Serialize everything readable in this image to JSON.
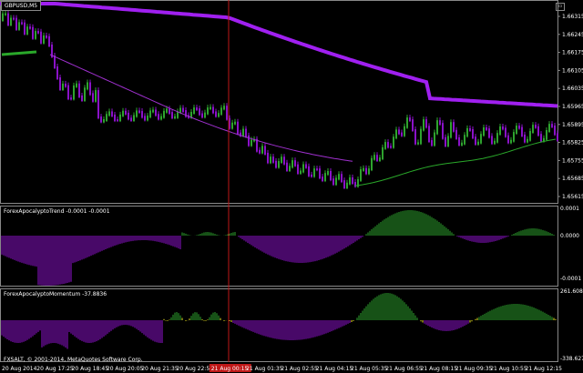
{
  "symbol_label": "GBPUSD,M5",
  "corner_button": "▭",
  "colors": {
    "background": "#000000",
    "bull": "#2ea32e",
    "bear": "#8a12c8",
    "neutral": "#d0d0d0",
    "ma_slow": "#a020f0",
    "ma_fast_green": "#2aa82a",
    "ma_fast_purple": "#a030d0",
    "vline": "#c01818",
    "time_highlight": "#c01818",
    "hist_pos": "#2ea32e",
    "hist_neg": "#9012d0",
    "hist_zero": "#e8e020"
  },
  "price_scale": [
    "1.66315",
    "1.66245",
    "1.66175",
    "1.66105",
    "1.66035",
    "1.65965",
    "1.65895",
    "1.65825",
    "1.65755",
    "1.65685",
    "1.65615"
  ],
  "trend_panel": {
    "label": "ForexApocalyptoTrend -0.0001 -0.0001",
    "scale": [
      "0.0001",
      "0.0000",
      "-0.0001"
    ]
  },
  "momentum_panel": {
    "label": "ForexApocalyptoMomentum -37.8836",
    "scale": [
      "261.6083",
      "-338.627"
    ]
  },
  "copyright": "FXSALT, © 2001-2014, MetaQuotes Software Corp.",
  "time_axis": [
    "20 Aug 2014",
    "20 Aug 17:25",
    "20 Aug 18:45",
    "20 Aug 20:05",
    "20 Aug 21:35",
    "20 Aug 22:55",
    "21 Aug 00:15",
    "21 Aug 01:35",
    "21 Aug 02:55",
    "21 Aug 04:15",
    "21 Aug 05:35",
    "21 Aug 06:55",
    "21 Aug 08:15",
    "21 Aug 09:35",
    "21 Aug 10:55",
    "21 Aug 12:15"
  ],
  "time_highlight_label": "21 Aug 00:15"
}
